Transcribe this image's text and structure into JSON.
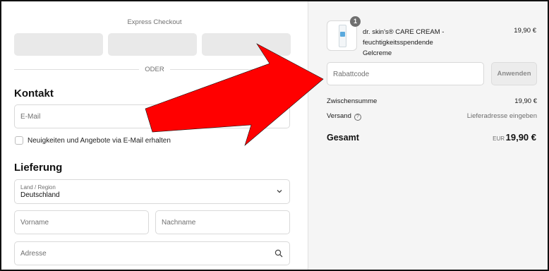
{
  "express": {
    "title": "Express Checkout",
    "or_label": "ODER"
  },
  "contact": {
    "title": "Kontakt",
    "email_placeholder": "E-Mail",
    "newsletter_label": "Neuigkeiten und Angebote via E-Mail erhalten"
  },
  "delivery": {
    "title": "Lieferung",
    "country_label": "Land / Region",
    "country_value": "Deutschland",
    "first_name_placeholder": "Vorname",
    "last_name_placeholder": "Nachname",
    "address_placeholder": "Adresse"
  },
  "cart": {
    "quantity": "1",
    "product_name": "dr. skin's® CARE CREAM - feuchtigkeitsspendende Gelcreme",
    "product_price": "19,90 €",
    "discount_placeholder": "Rabattcode",
    "apply_label": "Anwenden",
    "subtotal_label": "Zwischensumme",
    "subtotal_value": "19,90 €",
    "shipping_label": "Versand",
    "shipping_value": "Lieferadresse eingeben",
    "total_label": "Gesamt",
    "currency": "EUR",
    "total_value": "19,90 €"
  },
  "colors": {
    "annotation_arrow": "#ff0000",
    "sidebar_bg": "#f5f5f5",
    "express_button": "#e9e9e9"
  },
  "icons": [
    "chevron-down-icon",
    "search-icon",
    "help-circle-icon",
    "arrow-annotation-icon"
  ]
}
